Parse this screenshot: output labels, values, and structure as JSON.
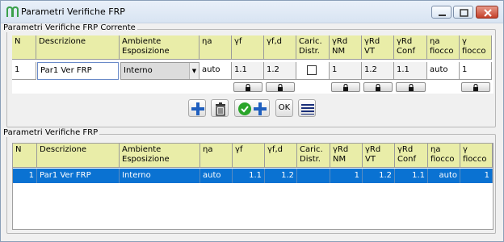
{
  "window": {
    "title": "Parametri Verifiche FRP"
  },
  "current_group": {
    "label": "Parametri Verifiche FRP Corrente"
  },
  "list_group": {
    "label": "Parametri Verifiche FRP"
  },
  "headers": [
    "N",
    "Descrizione",
    "Ambiente Esposizione",
    "ηa",
    "γf",
    "γf,d",
    "Caric. Distr.",
    "γRd NM",
    "γRd VT",
    "γRd Conf",
    "ηa fiocco",
    "γ fiocco"
  ],
  "current_row": {
    "n": "1",
    "descrizione": "Par1 Ver FRP",
    "ambiente": "Interno",
    "eta_a": "auto",
    "gamma_f": "1.1",
    "gamma_fd": "1.2",
    "caric_distr": false,
    "gamma_rd_nm": "1",
    "gamma_rd_vt": "1.2",
    "gamma_rd_conf": "1.1",
    "eta_a_fiocco": "auto",
    "gamma_fiocco": "1"
  },
  "toolbar": {
    "ok_label": "OK"
  },
  "rows": [
    {
      "n": "1",
      "descrizione": "Par1 Ver FRP",
      "ambiente": "Interno",
      "eta_a": "auto",
      "gamma_f": "1.1",
      "gamma_fd": "1.2",
      "caric_distr": "",
      "gamma_rd_nm": "1",
      "gamma_rd_vt": "1.2",
      "gamma_rd_conf": "1.1",
      "eta_a_fiocco": "auto",
      "gamma_fiocco": "1"
    }
  ],
  "colors": {
    "header_bg": "#e9eda8",
    "selection": "#0a72d2",
    "accent_blue": "#1f5fbf",
    "check_green": "#2aa52a"
  }
}
